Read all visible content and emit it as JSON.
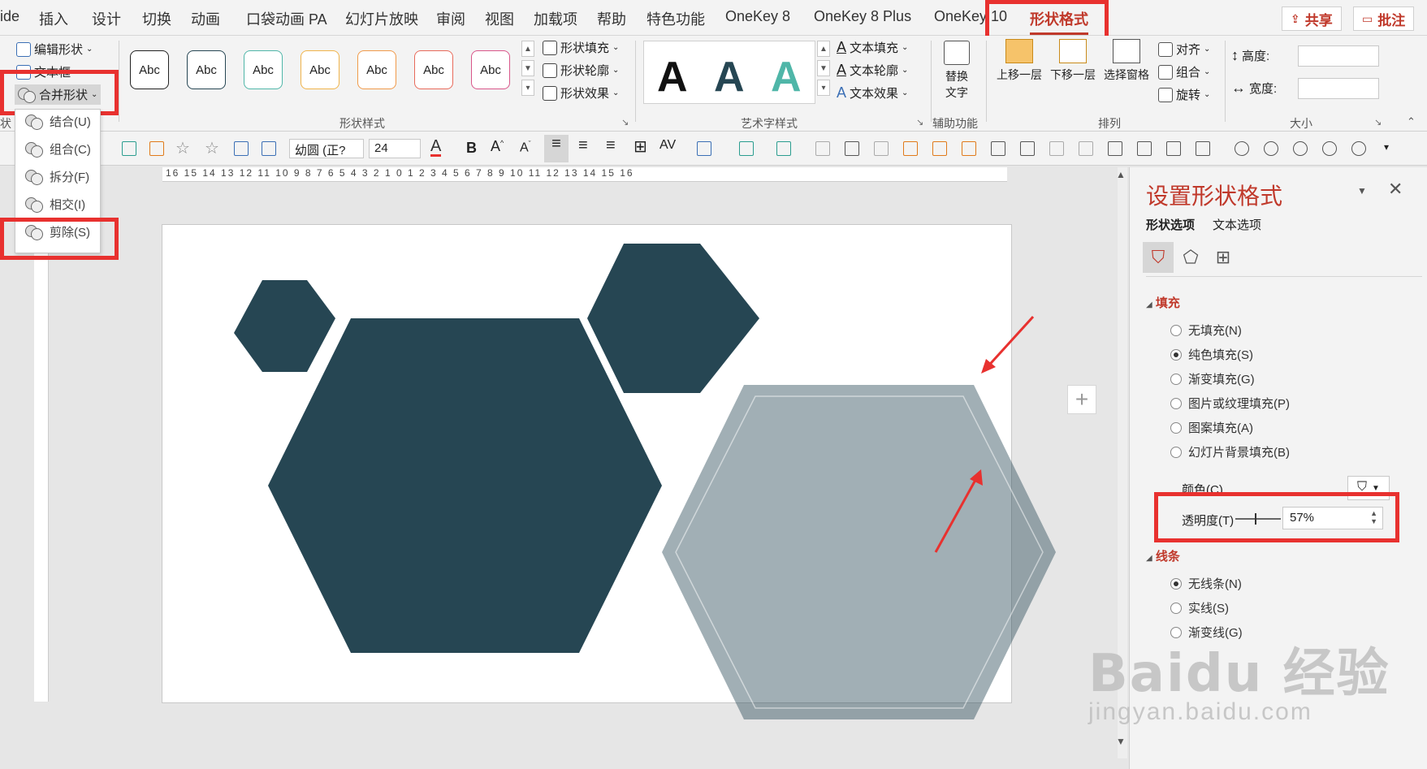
{
  "tabs": [
    {
      "label": "ide"
    },
    {
      "label": "插入"
    },
    {
      "label": "设计"
    },
    {
      "label": "切换"
    },
    {
      "label": "动画"
    },
    {
      "label": "口袋动画 PA"
    },
    {
      "label": "幻灯片放映"
    },
    {
      "label": "审阅"
    },
    {
      "label": "视图"
    },
    {
      "label": "加载项"
    },
    {
      "label": "帮助"
    },
    {
      "label": "特色功能"
    },
    {
      "label": "OneKey 8"
    },
    {
      "label": "OneKey 8 Plus"
    },
    {
      "label": "OneKey 10"
    },
    {
      "label": "形状格式"
    }
  ],
  "header_actions": {
    "share": "共享",
    "comment": "批注"
  },
  "ribbon": {
    "insert_shape": {
      "edit_shape": "编辑形状",
      "text_box": "文本框",
      "merge_shapes": "合并形状",
      "partial_label": "状"
    },
    "shape_styles": {
      "abc_label": "Abc",
      "fill": "形状填充",
      "outline": "形状轮廓",
      "effects": "形状效果",
      "group_label": "形状样式"
    },
    "wordart": {
      "letter": "A",
      "text_fill": "文本填充",
      "text_outline": "文本轮廓",
      "text_effects": "文本效果",
      "group_label": "艺术字样式"
    },
    "accessibility": {
      "alt_text_1": "替换",
      "alt_text_2": "文字",
      "group_label": "辅助功能"
    },
    "arrange": {
      "bring_forward": "上移一层",
      "send_backward": "下移一层",
      "selection_pane": "选择窗格",
      "align": "对齐",
      "group": "组合",
      "rotate": "旋转",
      "group_label": "排列"
    },
    "size": {
      "height": "高度:",
      "width": "宽度:",
      "group_label": "大小"
    }
  },
  "toolbar2": {
    "font_name": "幼圆 (正?",
    "font_size": "24",
    "bold": "B"
  },
  "merge_menu": {
    "items": [
      {
        "label": "结合(U)"
      },
      {
        "label": "组合(C)"
      },
      {
        "label": "拆分(F)"
      },
      {
        "label": "相交(I)"
      },
      {
        "label": "剪除(S)"
      }
    ]
  },
  "ruler_text": "16 15 14 13 12 11 10 9 8 7 6 5 4 3 2 1 0 1 2 3 4 5 6 7 8 9 10 11 12 13 14 15 16",
  "pane": {
    "title": "设置形状格式",
    "tabs": {
      "shape_options": "形状选项",
      "text_options": "文本选项"
    },
    "fill_section": "填充",
    "fill_options": [
      {
        "label": "无填充(N)",
        "selected": false
      },
      {
        "label": "纯色填充(S)",
        "selected": true
      },
      {
        "label": "渐变填充(G)",
        "selected": false
      },
      {
        "label": "图片或纹理填充(P)",
        "selected": false
      },
      {
        "label": "图案填充(A)",
        "selected": false
      },
      {
        "label": "幻灯片背景填充(B)",
        "selected": false
      }
    ],
    "color_label": "颜色(C)",
    "transparency_label": "透明度(T)",
    "transparency_value": "57%",
    "line_section": "线条",
    "line_options": [
      {
        "label": "无线条(N)",
        "selected": true
      },
      {
        "label": "实线(S)",
        "selected": false
      },
      {
        "label": "渐变线(G)",
        "selected": false
      }
    ]
  },
  "watermark": {
    "brand": "Baidu 经验",
    "url": "jingyan.baidu.com"
  },
  "colors": {
    "accent": "#c0392b",
    "shape_dark": "#264653",
    "shape_light": "#9fadb4",
    "highlight": "#e8312f"
  }
}
